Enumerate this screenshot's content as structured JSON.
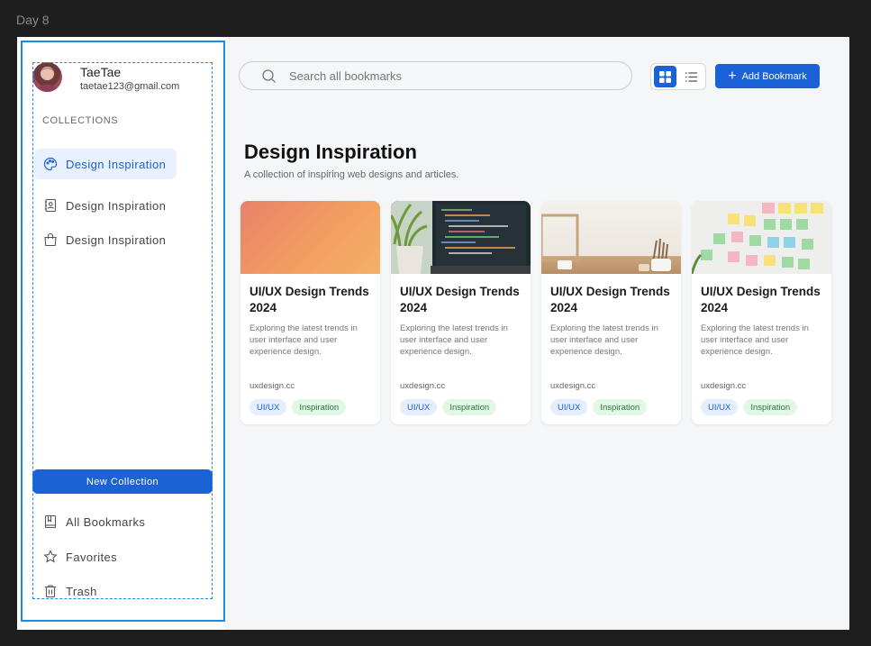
{
  "frame_label": "Day 8",
  "user": {
    "name": "TaeTae",
    "email": "taetae123@gmail.com"
  },
  "sidebar": {
    "collections_label": "COLLECTIONS",
    "collections": [
      {
        "label": "Design Inspiration",
        "icon": "palette-icon",
        "active": true
      },
      {
        "label": "Design Inspiration",
        "icon": "contact-book-icon",
        "active": false
      },
      {
        "label": "Design Inspiration",
        "icon": "shopping-bag-icon",
        "active": false
      }
    ],
    "new_collection_label": "New Collection",
    "bottom_items": [
      {
        "label": "All Bookmarks",
        "icon": "bookmark-book-icon"
      },
      {
        "label": "Favorites",
        "icon": "star-icon"
      },
      {
        "label": "Trash",
        "icon": "trash-icon"
      }
    ]
  },
  "search": {
    "placeholder": "Search all bookmarks",
    "value": ""
  },
  "toolbar": {
    "grid_view_active": true,
    "add_label": "Add Bookmark"
  },
  "page": {
    "title": "Design Inspiration",
    "description": "A collection of inspiring web designs and articles."
  },
  "cards": [
    {
      "title": "UI/UX Design Trends 2024",
      "description": "Exploring the latest trends in user interface and user experience design.",
      "domain": "uxdesign.cc",
      "tags": [
        "UI/UX",
        "Inspiration"
      ]
    },
    {
      "title": "UI/UX Design Trends 2024",
      "description": "Exploring the latest trends in user interface and user experience design.",
      "domain": "uxdesign.cc",
      "tags": [
        "UI/UX",
        "Inspiration"
      ]
    },
    {
      "title": "UI/UX Design Trends 2024",
      "description": "Exploring the latest trends in user interface and user experience design.",
      "domain": "uxdesign.cc",
      "tags": [
        "UI/UX",
        "Inspiration"
      ]
    },
    {
      "title": "UI/UX Design Trends 2024",
      "description": "Exploring the latest trends in user interface and user experience design.",
      "domain": "uxdesign.cc",
      "tags": [
        "UI/UX",
        "Inspiration"
      ]
    }
  ],
  "colors": {
    "accent": "#1a62d6",
    "active_bg": "#e8f1fd",
    "tag_blue_bg": "#e4eefc",
    "tag_green_bg": "#e3f7e7",
    "selection": "#1e88e5"
  }
}
